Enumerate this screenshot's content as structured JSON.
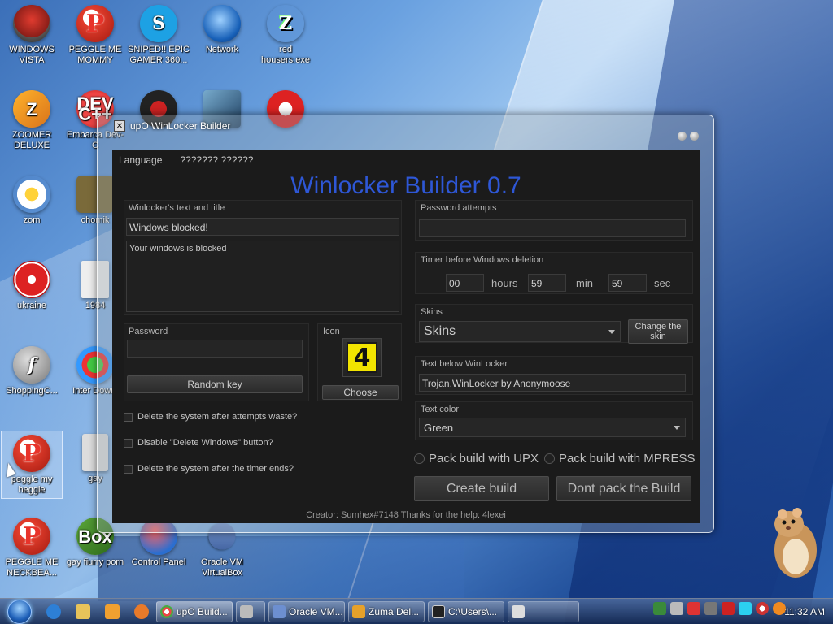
{
  "desktop": {
    "icons": [
      {
        "label": "WINDOWS VISTA"
      },
      {
        "label": "PEGGLE ME MOMMY"
      },
      {
        "label": "SNIPED!! EPIC GAMER 360..."
      },
      {
        "label": "Network"
      },
      {
        "label": "red housers.exe"
      },
      {
        "label": "ZOOMER DELUXE"
      },
      {
        "label": "Embarca Dev-C"
      },
      {
        "label": "zom"
      },
      {
        "label": "chomik"
      },
      {
        "label": "ukraine"
      },
      {
        "label": "1984"
      },
      {
        "label": "ShoppingC..."
      },
      {
        "label": "Inter Downl"
      },
      {
        "label": "peggle my heggle"
      },
      {
        "label": "gay"
      },
      {
        "label": "PEGGLE ME NECKBEA..."
      },
      {
        "label": "gay fiurry porn"
      },
      {
        "label": "Control Panel"
      },
      {
        "label": "Oracle VM VirtualBox"
      }
    ],
    "icon_glyphs": {
      "peggle": "P",
      "skype": "S",
      "zoomer": "Z",
      "red_housers": "Z",
      "dev": "DEV C++",
      "flash": "f",
      "box": "Box"
    }
  },
  "window": {
    "title": "upO WinLocker Builder",
    "menu": [
      "Language",
      "??????? ??????"
    ],
    "heading": "Winlocker Builder 0.7",
    "text_title_group": {
      "label": "Winlocker's text and title",
      "title_value": "Windows blocked!",
      "body_value": "Your windows is blocked"
    },
    "password_group": {
      "label": "Password",
      "value": "",
      "random_key_button": "Random key"
    },
    "icon_group": {
      "label": "Icon",
      "choose_button": "Choose",
      "preview_glyph": "4"
    },
    "checkboxes": [
      {
        "label": "Delete the system after attempts waste?",
        "checked": false
      },
      {
        "label": "Disable \"Delete Windows\" button?",
        "checked": false
      },
      {
        "label": "Delete the system after the timer ends?",
        "checked": false
      }
    ],
    "password_attempts": {
      "label": "Password attempts",
      "value": ""
    },
    "timer": {
      "label": "Timer before Windows deletion",
      "hours_value": "00",
      "hours_unit": "hours",
      "min_value": "59",
      "min_unit": "min",
      "sec_value": "59",
      "sec_unit": "sec"
    },
    "skins": {
      "label": "Skins",
      "selected": "Skins",
      "change_button": "Change the skin"
    },
    "text_below": {
      "label": "Text below WinLocker",
      "value": "Trojan.WinLocker by Anonymoose"
    },
    "text_color": {
      "label": "Text color",
      "selected": "Green"
    },
    "pack_options": [
      {
        "label": "Pack build with UPX",
        "selected": false
      },
      {
        "label": "Pack build with MPRESS",
        "selected": false
      }
    ],
    "create_button": "Create build",
    "dont_pack_button": "Dont pack the Build",
    "footer": "Creator: Sumhex#7148 Thanks for the help: 4lexei"
  },
  "taskbar": {
    "tasks": [
      {
        "label": "upO Build...",
        "color": "#e44"
      },
      {
        "label": "",
        "color": "#bbb"
      },
      {
        "label": "Oracle VM...",
        "color": "#6d8fd0"
      },
      {
        "label": "Zuma Del...",
        "color": "#e6a12a"
      },
      {
        "label": "C:\\Users\\...",
        "color": "#333"
      },
      {
        "label": "",
        "color": "#ddd"
      }
    ],
    "clock": "11:32 AM"
  }
}
